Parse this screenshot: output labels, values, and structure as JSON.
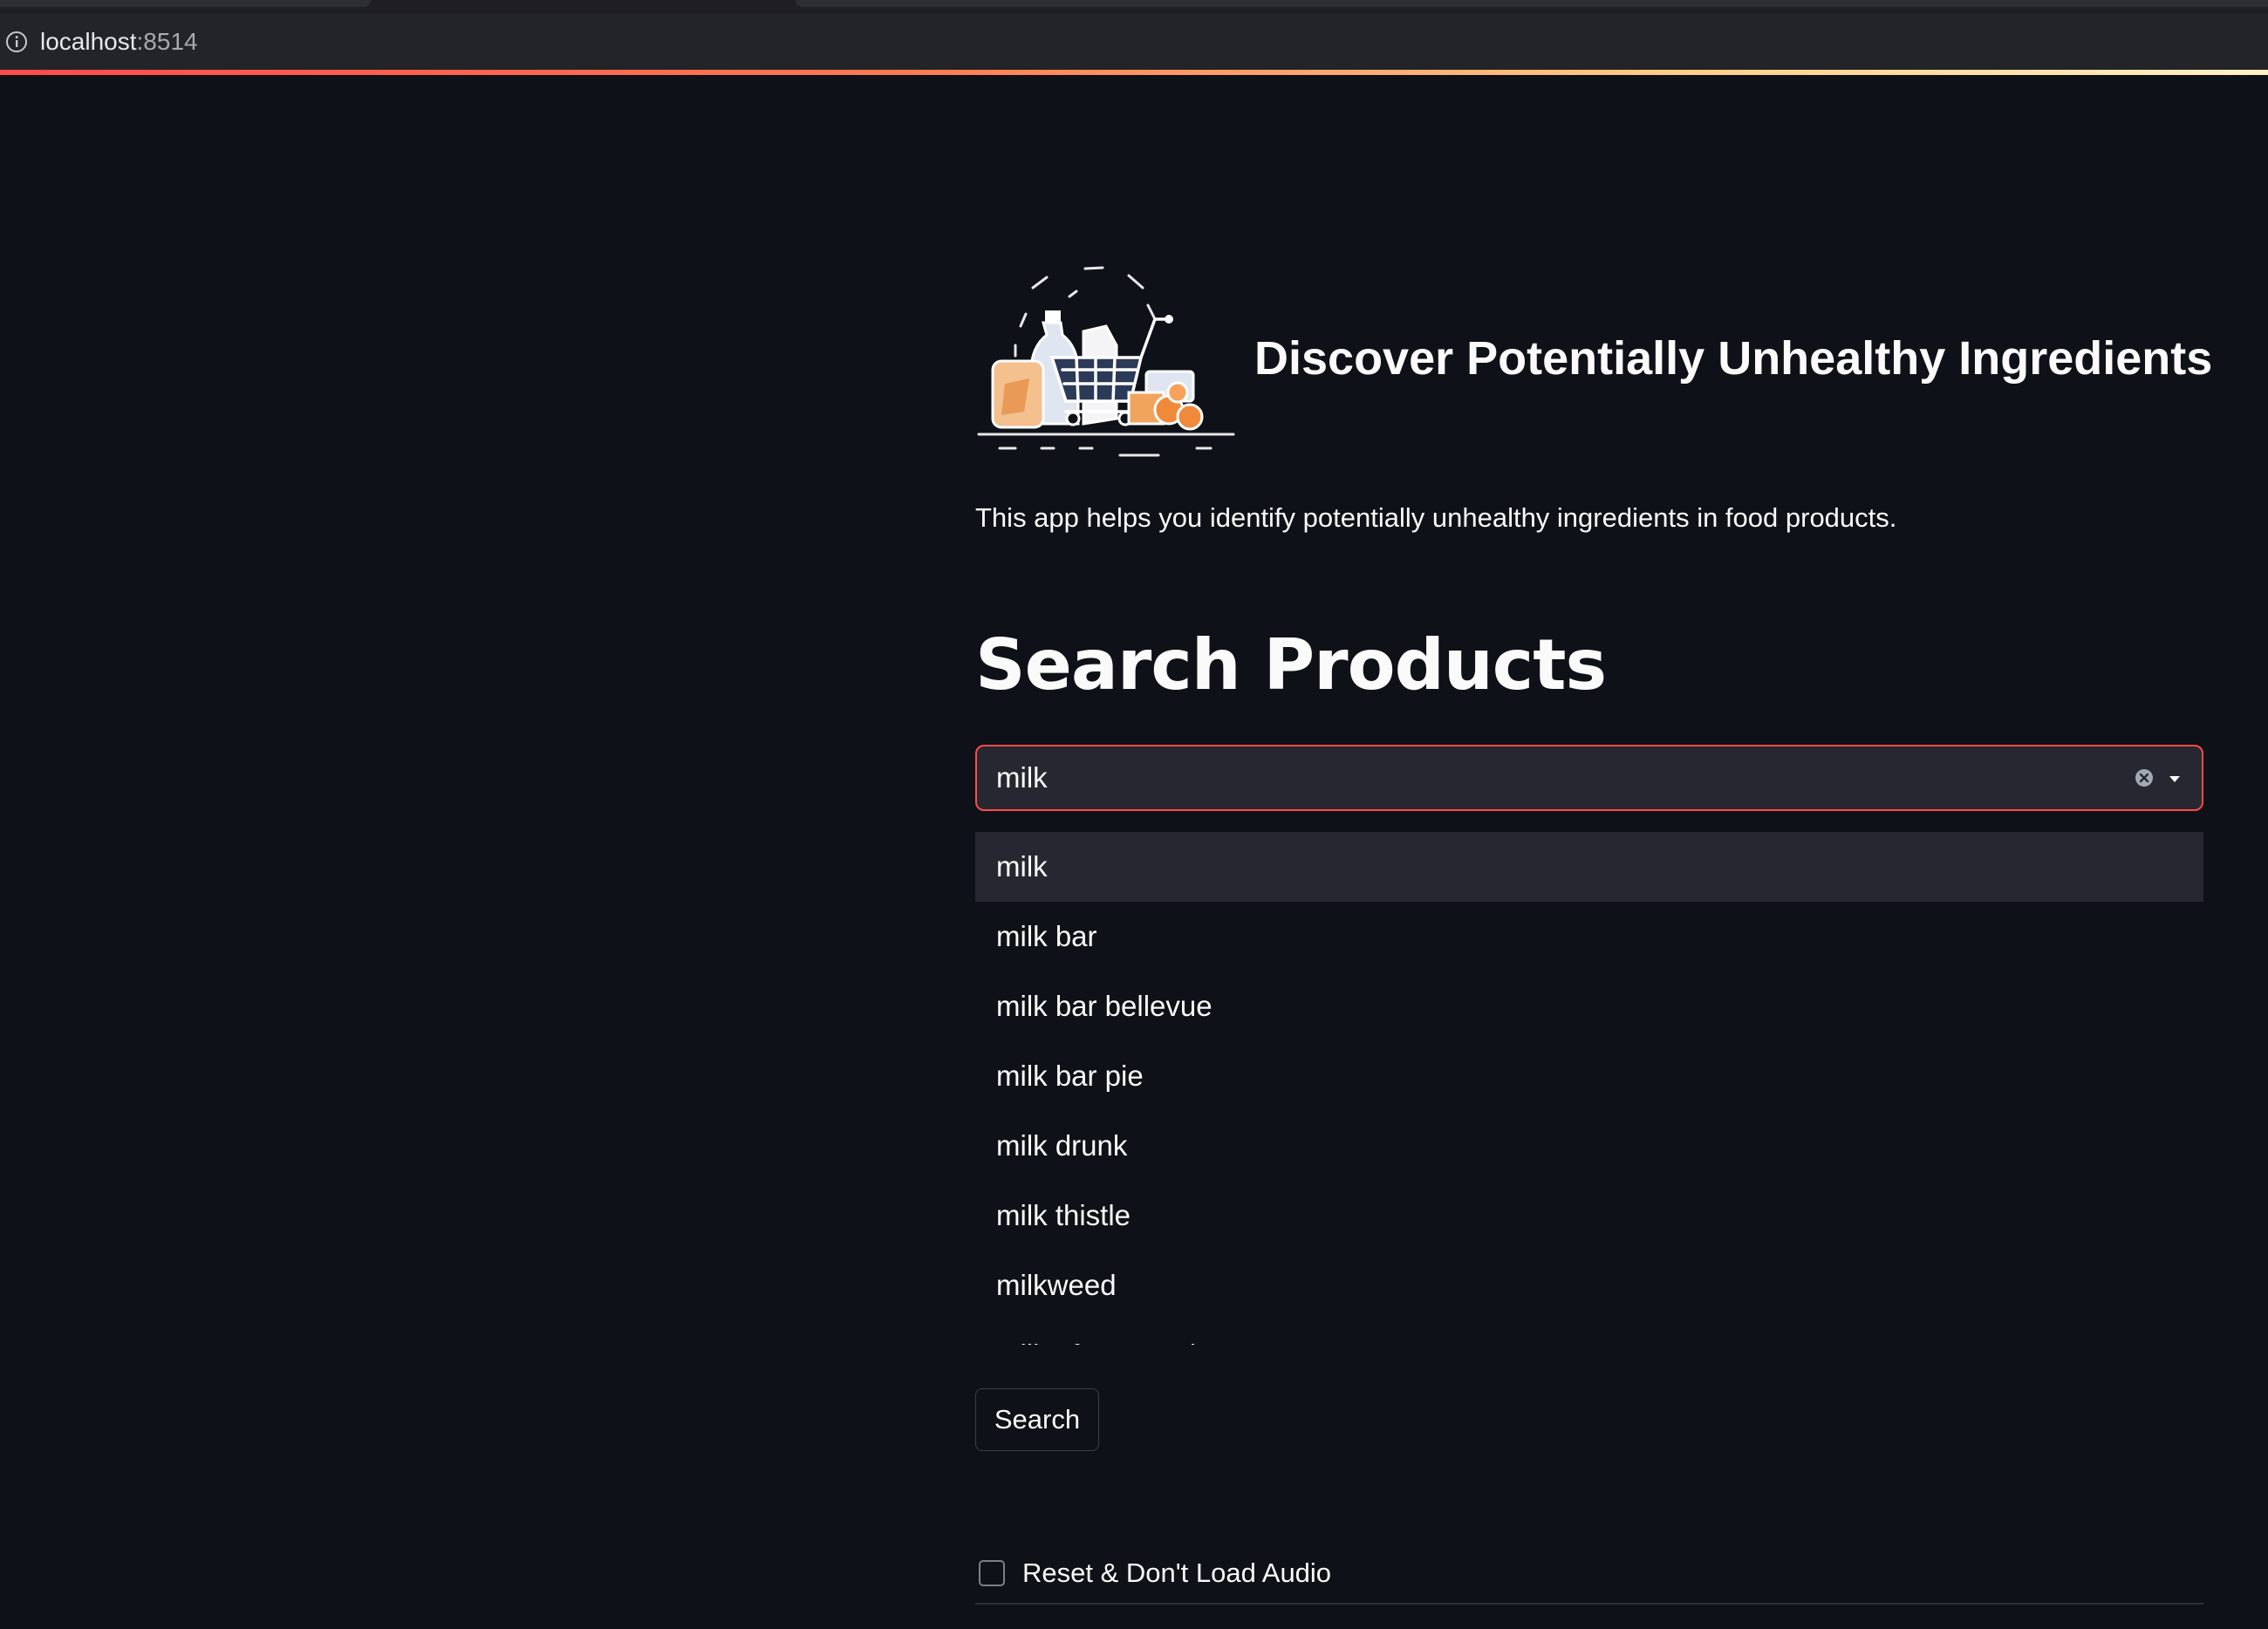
{
  "browser": {
    "url_host": "localhost",
    "url_port": ":8514"
  },
  "app": {
    "title": "Discover Potentially Unhealthy Ingredients",
    "intro": "This app helps you identify potentially unhealthy ingredients in food products.",
    "logo_icon": "grocery-cart-illustration",
    "accent_color": "#ff4b4b"
  },
  "search": {
    "heading": "Search Products",
    "query": "milk",
    "options": [
      "milk",
      "milk bar",
      "milk bar bellevue",
      "milk bar pie",
      "milk drunk",
      "milk thistle",
      "milkweed",
      "milk of magnesia"
    ],
    "highlighted_option": "milk",
    "button_label": "Search"
  },
  "reset_checkbox": {
    "label": "Reset & Don't Load Audio",
    "checked": false
  }
}
